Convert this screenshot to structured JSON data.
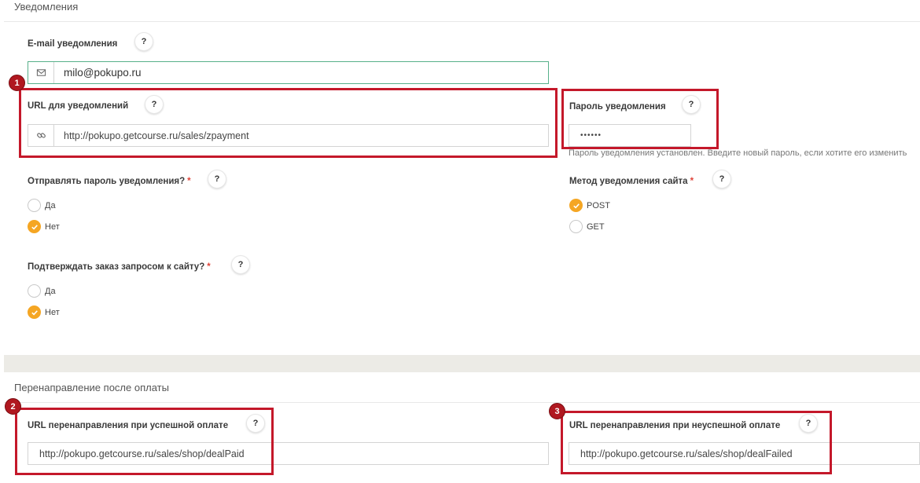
{
  "notifications": {
    "section_title": "Уведомления",
    "email": {
      "label": "E-mail уведомления",
      "value": "milo@pokupo.ru",
      "help": "?"
    },
    "url": {
      "label": "URL для уведомлений",
      "value": "http://pokupo.getcourse.ru/sales/zpayment",
      "help": "?"
    },
    "password": {
      "label": "Пароль уведомления",
      "value": "••••••",
      "help": "?",
      "hint": "Пароль уведомления установлен. Введите новый пароль, если хотите его изменить"
    },
    "send_password": {
      "label": "Отправлять пароль уведомления?",
      "required": "*",
      "help": "?",
      "options": [
        "Да",
        "Нет"
      ],
      "selected": "Нет"
    },
    "method": {
      "label": "Метод уведомления сайта",
      "required": "*",
      "help": "?",
      "options": [
        "POST",
        "GET"
      ],
      "selected": "POST"
    },
    "confirm_order": {
      "label": "Подтверждать заказ запросом к сайту?",
      "required": "*",
      "help": "?",
      "options": [
        "Да",
        "Нет"
      ],
      "selected": "Нет"
    }
  },
  "redirect": {
    "section_title": "Перенаправление после оплаты",
    "success": {
      "label": "URL перенаправления при успешной оплате",
      "value": "http://pokupo.getcourse.ru/sales/shop/dealPaid",
      "help": "?"
    },
    "fail": {
      "label": "URL перенаправления при неуспешной оплате",
      "value": "http://pokupo.getcourse.ru/sales/shop/dealFailed",
      "help": "?"
    }
  },
  "annotations": {
    "badge1": "1",
    "badge2": "2",
    "badge3": "3"
  },
  "colors": {
    "accent": "#f5a623",
    "highlight": "#c4182a",
    "focus": "#57b08a"
  }
}
